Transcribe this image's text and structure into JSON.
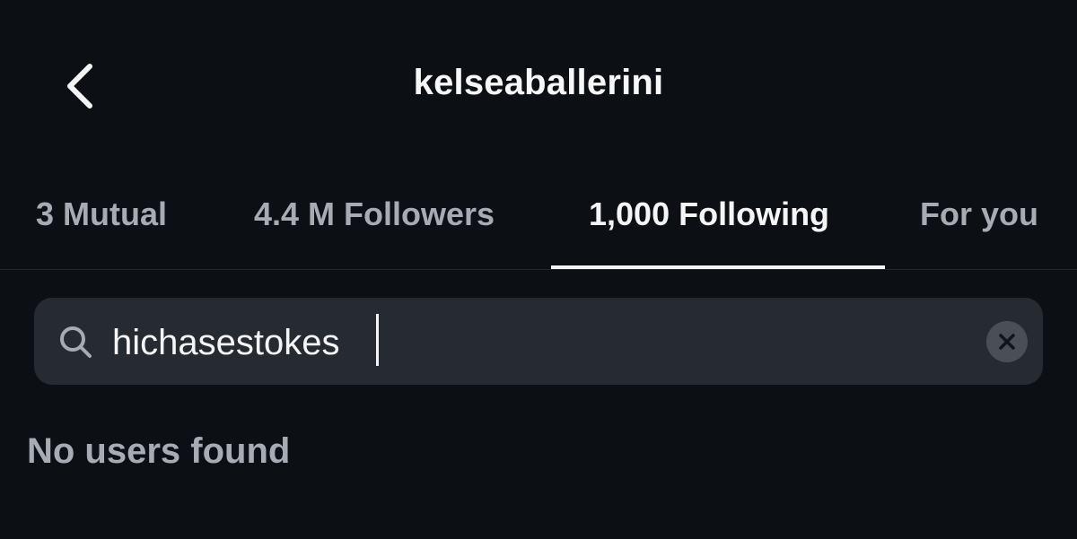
{
  "header": {
    "title": "kelseaballerini",
    "back_icon": "chevron-left-icon"
  },
  "tabs": [
    {
      "label": "3 Mutual",
      "active": false
    },
    {
      "label": "4.4 M Followers",
      "active": false
    },
    {
      "label": "1,000 Following",
      "active": true
    },
    {
      "label": "For you",
      "active": false
    }
  ],
  "search": {
    "value": "hichasestokes",
    "search_icon": "search-icon",
    "clear_icon": "clear-icon"
  },
  "results": {
    "empty_message": "No users found"
  },
  "colors": {
    "background": "#0c0f14",
    "search_field": "#262a31",
    "active_text": "#f5f5f5",
    "inactive_text": "#a7abb3"
  }
}
